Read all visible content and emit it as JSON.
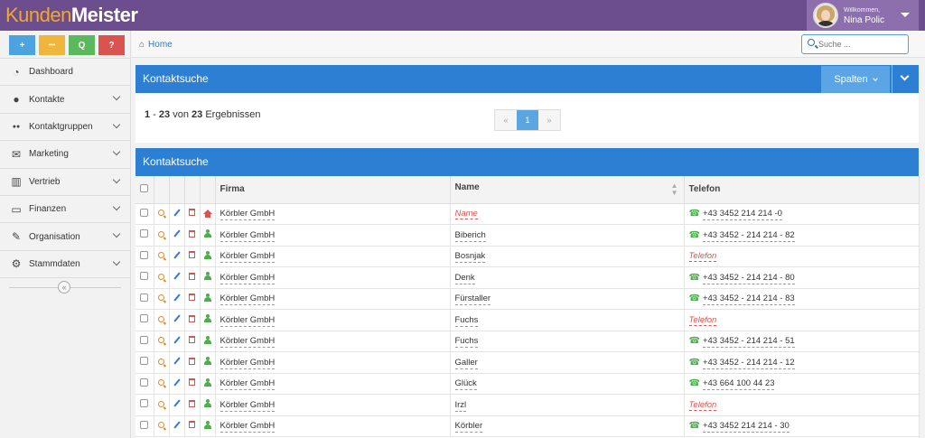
{
  "app": {
    "logo_part1": "Kunden",
    "logo_part2": "Meister"
  },
  "user": {
    "greeting": "Willkommen,",
    "name": "Nina Polic"
  },
  "quick_actions": [
    {
      "icon": "plus-icon",
      "glyph": "+",
      "color": "#4da3e0"
    },
    {
      "icon": "chat-icon",
      "glyph": "•••",
      "color": "#f0b63c"
    },
    {
      "icon": "search-icon",
      "glyph": "Q",
      "color": "#5cb85c"
    },
    {
      "icon": "help-icon",
      "glyph": "?",
      "color": "#d9534f"
    }
  ],
  "sidebar": {
    "items": [
      {
        "label": "Dashboard",
        "icon": "dashboard-icon",
        "glyph": "◔",
        "expandable": false
      },
      {
        "label": "Kontakte",
        "icon": "user-icon",
        "glyph": "●",
        "expandable": true
      },
      {
        "label": "Kontaktgruppen",
        "icon": "group-icon",
        "glyph": "●●",
        "expandable": true
      },
      {
        "label": "Marketing",
        "icon": "envelope-icon",
        "glyph": "✉",
        "expandable": true
      },
      {
        "label": "Vertrieb",
        "icon": "bar-chart-icon",
        "glyph": "▥",
        "expandable": true
      },
      {
        "label": "Finanzen",
        "icon": "money-icon",
        "glyph": "▭",
        "expandable": true
      },
      {
        "label": "Organisation",
        "icon": "edit-icon",
        "glyph": "✎",
        "expandable": true
      },
      {
        "label": "Stammdaten",
        "icon": "cogs-icon",
        "glyph": "⚙",
        "expandable": true
      }
    ],
    "collapse_glyph": "«"
  },
  "breadcrumb": {
    "home_label": "Home"
  },
  "search": {
    "placeholder": "Suche ..."
  },
  "search_panel": {
    "title": "Kontaktsuche",
    "columns_button": "Spalten",
    "results": {
      "from": "1",
      "to": "23",
      "of_word": "von",
      "total": "23",
      "suffix": "Ergebnissen"
    },
    "pager": {
      "prev": "«",
      "current": "1",
      "next": "»"
    }
  },
  "table_panel": {
    "title": "Kontaktsuche",
    "headers": {
      "firma": "Firma",
      "name": "Name",
      "telefon": "Telefon"
    },
    "rows": [
      {
        "type": "company",
        "firma": "Körbler GmbH",
        "name": "Name",
        "name_empty": true,
        "telefon": "+43 3452 214 214 -0",
        "tel_empty": false
      },
      {
        "type": "person",
        "firma": "Körbler GmbH",
        "name": "Biberich",
        "name_empty": false,
        "telefon": "+43 3452 - 214 214 - 82",
        "tel_empty": false
      },
      {
        "type": "person",
        "firma": "Körbler GmbH",
        "name": "Bosnjak",
        "name_empty": false,
        "telefon": "Telefon",
        "tel_empty": true
      },
      {
        "type": "person",
        "firma": "Körbler GmbH",
        "name": "Denk",
        "name_empty": false,
        "telefon": "+43 3452 - 214 214 - 80",
        "tel_empty": false
      },
      {
        "type": "person",
        "firma": "Körbler GmbH",
        "name": "Fürstaller",
        "name_empty": false,
        "telefon": "+43 3452 - 214 214 - 83",
        "tel_empty": false
      },
      {
        "type": "person",
        "firma": "Körbler GmbH",
        "name": "Fuchs",
        "name_empty": false,
        "telefon": "Telefon",
        "tel_empty": true
      },
      {
        "type": "person",
        "firma": "Körbler GmbH",
        "name": "Fuchs",
        "name_empty": false,
        "telefon": "+43 3452 - 214 214 - 51",
        "tel_empty": false
      },
      {
        "type": "person",
        "firma": "Körbler GmbH",
        "name": "Galler",
        "name_empty": false,
        "telefon": "+43 3452 - 214 214 - 12",
        "tel_empty": false
      },
      {
        "type": "person",
        "firma": "Körbler GmbH",
        "name": "Glück",
        "name_empty": false,
        "telefon": "+43 664 100 44 23",
        "tel_empty": false
      },
      {
        "type": "person",
        "firma": "Körbler GmbH",
        "name": "Irzl",
        "name_empty": false,
        "telefon": "Telefon",
        "tel_empty": true
      },
      {
        "type": "person",
        "firma": "Körbler GmbH",
        "name": "Körbler",
        "name_empty": false,
        "telefon": "+43 3452 214 214 - 30",
        "tel_empty": false
      }
    ]
  },
  "colors": {
    "topbar": "#6c4d8d",
    "accent_blue": "#2d7fd3",
    "logo_orange": "#f3a82a"
  }
}
